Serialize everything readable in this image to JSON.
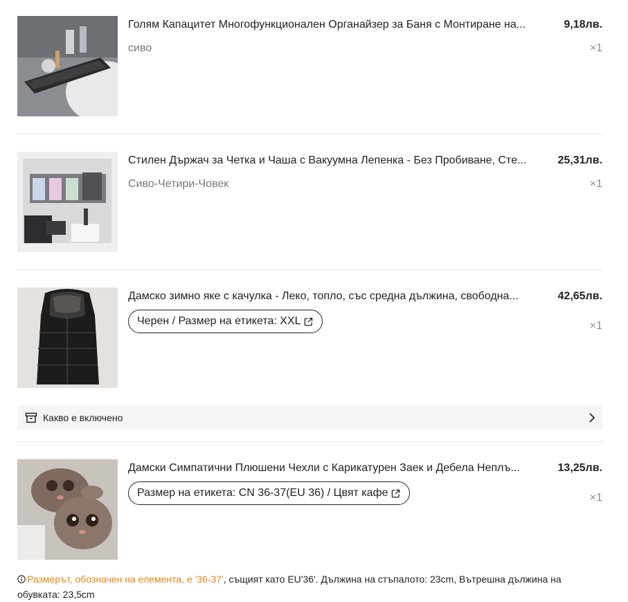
{
  "items": [
    {
      "title": "Голям Капацитет Многофункционален Органайзер за Баня с Монтиране на...",
      "price": "9,18лв.",
      "variant": "сиво",
      "qty": "×1"
    },
    {
      "title": "Стилен Държач за Четка и Чаша с Вакуумна Лепенка - Без Пробиване, Сте...",
      "price": "25,31лв.",
      "variant": "Сиво-Четири-Човек",
      "qty": "×1"
    },
    {
      "title": "Дамско зимно яке с качулка - Леко, топло, със средна дължина, свободна...",
      "price": "42,65лв.",
      "variant": "Черен / Размер на етикета: XXL",
      "qty": "×1"
    },
    {
      "title": "Дамски Симпатични Плюшени Чехли с Карикатурен Заек и Дебела Неплъ...",
      "price": "13,25лв.",
      "variant": "Размер на етикета: CN 36-37(EU 36) / Цвят кафе",
      "qty": "×1"
    }
  ],
  "included": {
    "label": "Какво е включено",
    "icon": "archive-box-icon",
    "chevron": "chevron-right-icon"
  },
  "size_note": {
    "warning": "Размерът, обозначен на елемента, е '36-37'",
    "detail": ", същият като EU'36'. Дължина на стъпалото: 23cm, Вътрешна дължина на обувката: 23,5cm"
  },
  "colors": {
    "warning": "#e58517",
    "text": "#222222",
    "muted": "#777777",
    "band": "#f5f5f5"
  }
}
